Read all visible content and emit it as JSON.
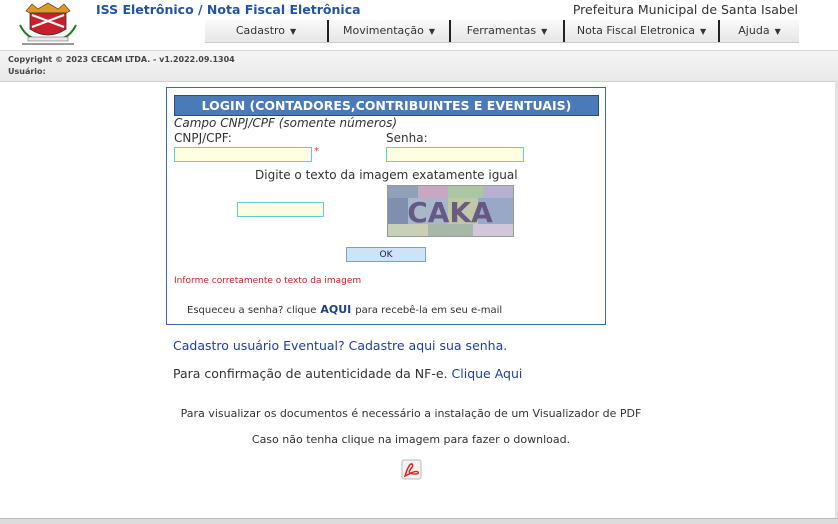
{
  "header": {
    "app_title": "ISS Eletrônico / Nota Fiscal Eletrônica",
    "prefeitura": "Prefeitura Municipal de Santa Isabel",
    "logo_icon": "municipal-coat-of-arms"
  },
  "menu": [
    {
      "label": "Cadastro"
    },
    {
      "label": "Movimentação"
    },
    {
      "label": "Ferramentas"
    },
    {
      "label": "Nota Fiscal Eletronica"
    },
    {
      "label": "Ajuda"
    }
  ],
  "info": {
    "copyright": "Copyright © 2023 CECAM LTDA. - v1.2022.09.1304",
    "usuario_label": "Usuário:"
  },
  "login": {
    "title": "LOGIN (CONTADORES,CONTRIBUINTES E EVENTUAIS)",
    "hint": "Campo CNPJ/CPF (somente números)",
    "cnpj_label": "CNPJ/CPF:",
    "cnpj_value": "",
    "senha_label": "Senha:",
    "senha_value": "",
    "required_mark": "*",
    "captcha_instruction": "Digite o texto da imagem exatamente igual",
    "captcha_input_value": "",
    "captcha_text": "CAKA",
    "ok_label": "OK",
    "error_message": "Informe corretamente o texto da imagem",
    "forgot_before": "Esqueceu a senha? clique",
    "forgot_link": "AQUI",
    "forgot_after": "para recebê-la em seu e-mail"
  },
  "links": {
    "cadastro_eventual": "Cadastro usuário Eventual? Cadastre aqui sua senha.",
    "confirmacao_text": "Para confirmação de autenticidade da NF-e.",
    "confirmacao_link": "Clique Aqui"
  },
  "pdf": {
    "line1": "Para visualizar os documentos é necessário a instalação de um Visualizador de PDF",
    "line2": "Caso não tenha clique na imagem para fazer o download.",
    "icon": "pdf-reader-icon"
  },
  "colors": {
    "title_bar": "#4a7ab7",
    "link": "#1f3fa0",
    "error": "#cc2222",
    "input_bg": "#ffffe0",
    "input_border": "#5fd0d8"
  }
}
